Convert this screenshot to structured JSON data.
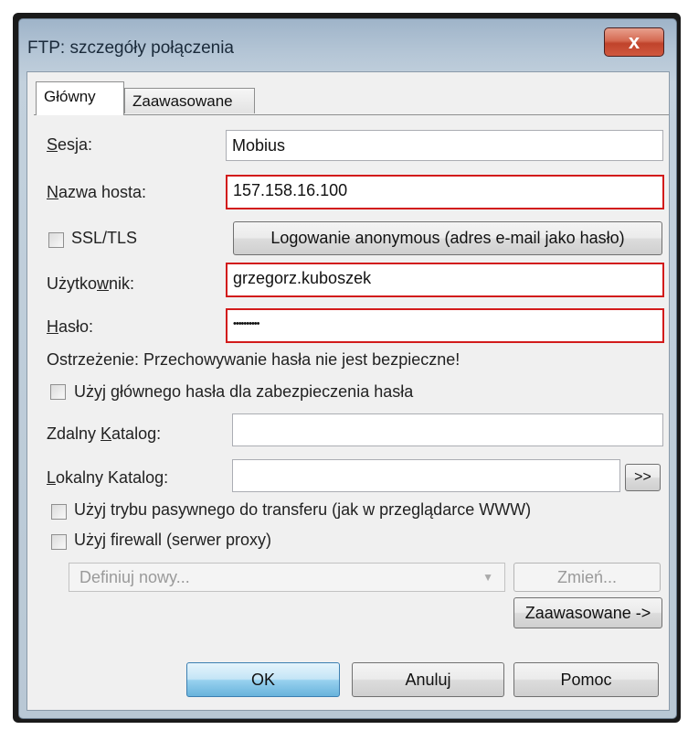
{
  "window": {
    "title": "FTP: szczegóły połączenia",
    "close_glyph": "x"
  },
  "tabs": [
    {
      "label": "Główny",
      "active": true
    },
    {
      "label": "Zaawasowane",
      "active": false
    }
  ],
  "form": {
    "session": {
      "label_u": "S",
      "label_rest": "esja:",
      "value": "Mobius"
    },
    "host": {
      "label_u": "N",
      "label_rest": "azwa hosta:",
      "value": "157.158.16.100"
    },
    "ssl_label": "SSL/TLS",
    "anon_button": "Logowanie anonymous (adres e-mail jako hasło)",
    "user": {
      "label_pre": "Użytko",
      "label_u": "w",
      "label_rest": "nik:",
      "value": "grzegorz.kuboszek"
    },
    "password": {
      "label_u": "H",
      "label_rest": "asło:",
      "value": "••••••••••"
    },
    "warning": "Ostrzeżenie: Przechowywanie hasła nie jest bezpieczne!",
    "master_password_label": "Użyj głównego hasła dla zabezpieczenia hasła",
    "remote_dir": {
      "label_pre": "Zdalny ",
      "label_u": "K",
      "label_rest": "atalog:",
      "value": ""
    },
    "local_dir": {
      "label_u": "L",
      "label_rest": "okalny Katalog:",
      "value": ""
    },
    "browse_button": ">>",
    "passive_label": "Użyj trybu pasywnego do transferu (jak w przeglądarce WWW)",
    "firewall_label": "Użyj firewall (serwer proxy)",
    "proxy_select": "Definiuj nowy...",
    "change_button": "Zmień...",
    "advanced_button": "Zaawasowane ->"
  },
  "footer": {
    "ok": "OK",
    "cancel": "Anuluj",
    "help": "Pomoc"
  },
  "colors": {
    "highlight_border": "#d21b1b",
    "close_button": "#c0432b"
  }
}
